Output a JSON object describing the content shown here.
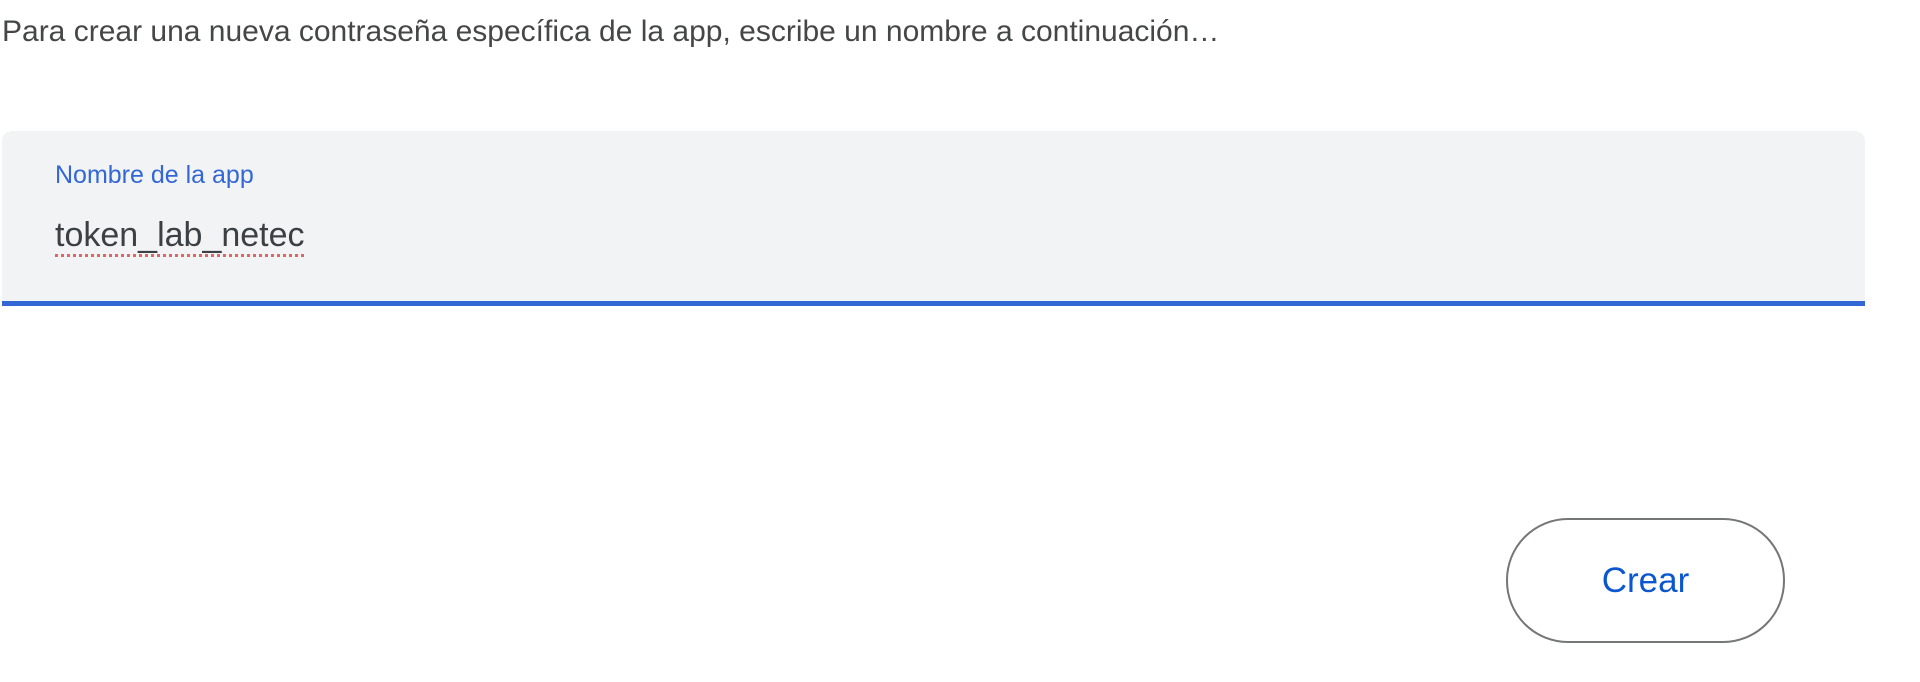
{
  "description": "Para crear una nueva contraseña específica de la app, escribe un nombre a continuación…",
  "app_name_field": {
    "label": "Nombre de la app",
    "value": "token_lab_netec"
  },
  "create_button": {
    "label": "Crear"
  },
  "colors": {
    "accent": "#3367d6",
    "field_bg": "#f1f3f4",
    "text": "#3c4043"
  }
}
